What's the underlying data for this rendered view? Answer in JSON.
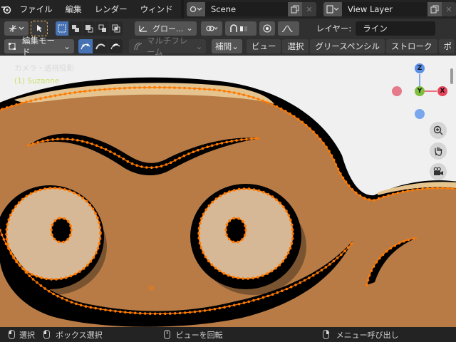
{
  "menubar": {
    "items": [
      "ファイル",
      "編集",
      "レンダー",
      "ウィンド"
    ],
    "scene": {
      "name": "Scene"
    },
    "view_layer": {
      "name": "View Layer"
    }
  },
  "header1": {
    "orientation_label": "グロー...",
    "layer_label": "レイヤー:",
    "layer_value": "ライン"
  },
  "header2": {
    "mode": "編集モード",
    "multiframe": "マルチフレーム",
    "interpolate": "補間",
    "menus": [
      "ビュー",
      "選択",
      "グリースペンシル",
      "ストローク",
      "ポ"
    ]
  },
  "viewport": {
    "view_name": "カメラ・透視投影",
    "object_name": "(1) Suzanne",
    "gizmo": {
      "x": "X",
      "y": "Y",
      "z": "Z"
    },
    "colors": {
      "skin": "#b87b46",
      "face": "#d6b796",
      "outline": "#000000",
      "highlight": "#e5c48f",
      "points": "#ff7a00"
    }
  },
  "statusbar": {
    "select": "選択",
    "box_select": "ボックス選択",
    "rotate_view": "ビューを回転",
    "call_menu": "メニュー呼び出し"
  }
}
